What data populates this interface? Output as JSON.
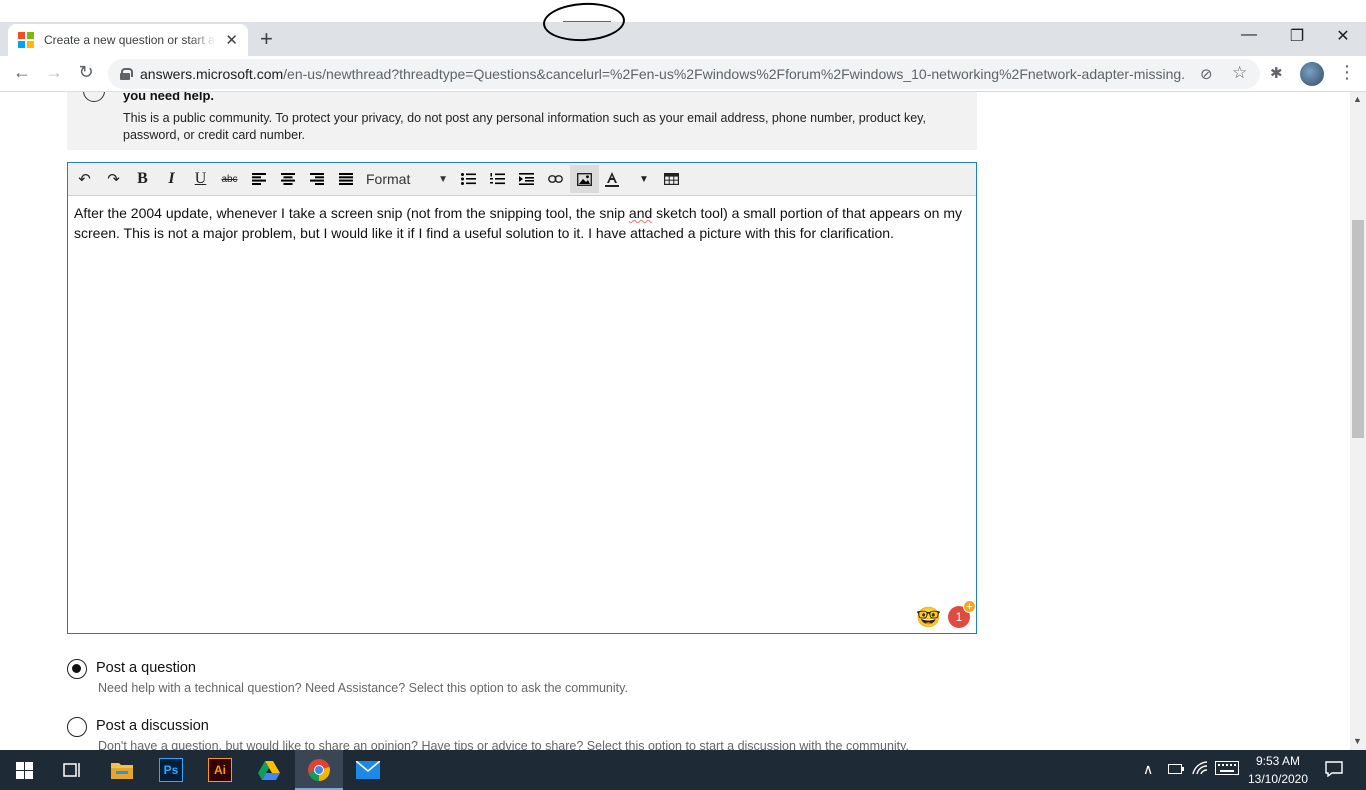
{
  "browser": {
    "tab_title": "Create a new question or start a discussion",
    "tab_close": "✕",
    "new_tab": "+",
    "url_host": "answers.microsoft.com",
    "url_path": "/en-us/newthread?threadtype=Questions&cancelurl=%2Fen-us%2Fwindows%2Fforum%2Fwindows_10-networking%2Fnetwork-adapter-missing...",
    "window_controls": {
      "minimize": "—",
      "restore": "❐",
      "close": "✕"
    },
    "nav": {
      "back": "←",
      "forward": "→",
      "reload": "↻"
    }
  },
  "notice": {
    "heading": "you need help.",
    "body": "This is a public community. To protect your privacy, do not post any personal information such as your email address, phone number, product key, password, or credit card number."
  },
  "editor": {
    "toolbar": {
      "undo": "↶",
      "redo": "↷",
      "bold": "B",
      "italic": "I",
      "underline": "U",
      "strike": "abc",
      "format_label": "Format"
    },
    "content_before": "After the 2004 update, whenever I take a screen snip (not from the snipping tool, the snip ",
    "content_spell": "and",
    "content_after": " sketch tool) a small portion of that appears on my screen. This is not a major problem, but I would like it if I find a useful solution to it. I have attached a picture with this for clarification.",
    "badge_count": "1",
    "emoji": "🤓"
  },
  "post_type": {
    "selected": "question",
    "options": [
      {
        "label": "Post a question",
        "description": "Need help with a technical question? Need Assistance? Select this option to ask the community."
      },
      {
        "label": "Post a discussion",
        "description": "Don't have a question, but would like to share an opinion? Have tips or advice to share? Select this option to start a discussion with the community."
      }
    ]
  },
  "taskbar": {
    "apps": [
      {
        "name": "photoshop",
        "label": "Ps"
      },
      {
        "name": "illustrator",
        "label": "Ai"
      }
    ],
    "time": "9:53 AM",
    "date": "13/10/2020"
  },
  "colors": {
    "accent": "#1e7bd1",
    "taskbar": "#1f2a37",
    "badge": "#e04a3f"
  }
}
